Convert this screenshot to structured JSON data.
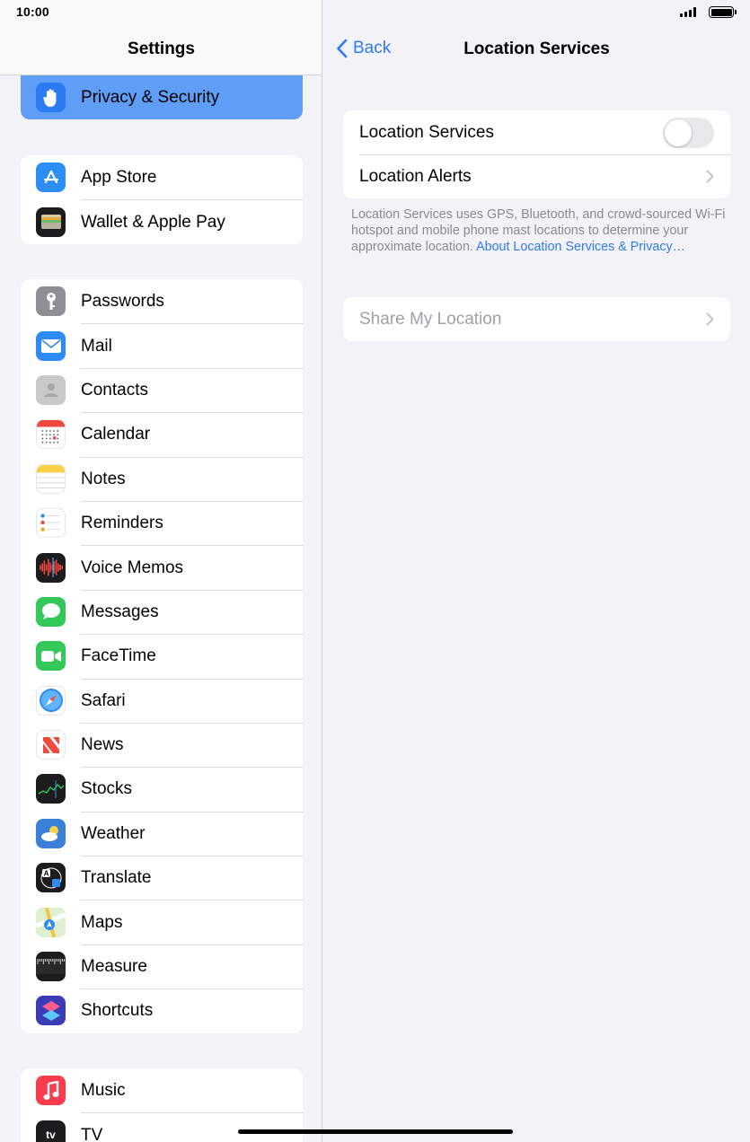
{
  "status": {
    "time": "10:00"
  },
  "sidebar": {
    "title": "Settings",
    "selected": {
      "label": "Privacy & Security",
      "icon": "hand-icon",
      "color": "#2c7bf3"
    },
    "group1": [
      {
        "label": "App Store",
        "icon": "app-store-icon",
        "color": "#2d8ff5"
      },
      {
        "label": "Wallet & Apple Pay",
        "icon": "wallet-icon",
        "color": "#1c1c1e"
      }
    ],
    "group2": [
      {
        "label": "Passwords",
        "icon": "key-icon",
        "color": "#8e8e93"
      },
      {
        "label": "Mail",
        "icon": "mail-icon",
        "color": "#2e8af6"
      },
      {
        "label": "Contacts",
        "icon": "contacts-icon",
        "color": "#c9c9c9"
      },
      {
        "label": "Calendar",
        "icon": "calendar-icon",
        "color": "#ffffff"
      },
      {
        "label": "Notes",
        "icon": "notes-icon",
        "color": "#ffffff"
      },
      {
        "label": "Reminders",
        "icon": "reminders-icon",
        "color": "#ffffff"
      },
      {
        "label": "Voice Memos",
        "icon": "voice-memos-icon",
        "color": "#1c1c1e"
      },
      {
        "label": "Messages",
        "icon": "messages-icon",
        "color": "#34c759"
      },
      {
        "label": "FaceTime",
        "icon": "facetime-icon",
        "color": "#34c759"
      },
      {
        "label": "Safari",
        "icon": "safari-icon",
        "color": "#ffffff"
      },
      {
        "label": "News",
        "icon": "news-icon",
        "color": "#ffffff"
      },
      {
        "label": "Stocks",
        "icon": "stocks-icon",
        "color": "#1c1c1e"
      },
      {
        "label": "Weather",
        "icon": "weather-icon",
        "color": "#3a80d8"
      },
      {
        "label": "Translate",
        "icon": "translate-icon",
        "color": "#1c1c1e"
      },
      {
        "label": "Maps",
        "icon": "maps-icon",
        "color": "#7fd37a"
      },
      {
        "label": "Measure",
        "icon": "measure-icon",
        "color": "#1c1c1e"
      },
      {
        "label": "Shortcuts",
        "icon": "shortcuts-icon",
        "color": "#3b3bb5"
      }
    ],
    "group3": [
      {
        "label": "Music",
        "icon": "music-icon",
        "color": "#fa3c4f"
      },
      {
        "label": "TV",
        "icon": "tv-icon",
        "color": "#1c1c1e"
      }
    ]
  },
  "detail": {
    "back_label": "Back",
    "title": "Location Services",
    "location_services_label": "Location Services",
    "location_alerts_label": "Location Alerts",
    "footnote_text": "Location Services uses GPS, Bluetooth, and crowd-sourced Wi-Fi hotspot and mobile phone mast locations to determine your approximate location. ",
    "footnote_link": "About Location Services & Privacy…",
    "share_my_location_label": "Share My Location",
    "location_services_on": false
  }
}
